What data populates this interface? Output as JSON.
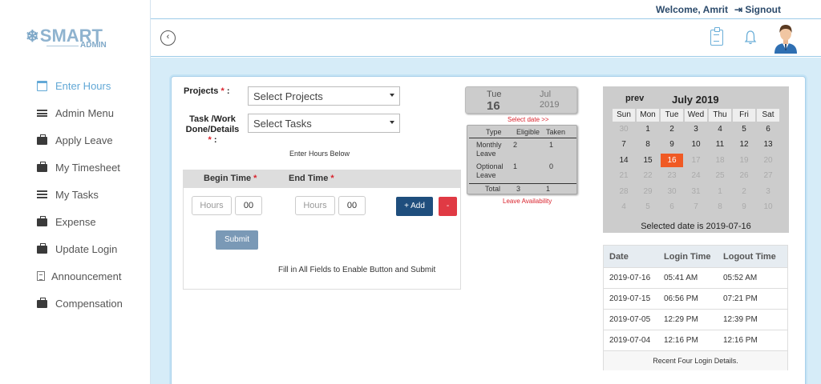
{
  "brand": {
    "name": "SMART",
    "sub": "ADMIN"
  },
  "topbar": {
    "welcome": "Welcome, Amrit",
    "signout": "Signout"
  },
  "sidebar": {
    "items": [
      {
        "label": "Enter Hours",
        "icon": "calendar-icon",
        "active": true
      },
      {
        "label": "Admin Menu",
        "icon": "menu-icon"
      },
      {
        "label": "Apply Leave",
        "icon": "briefcase-icon"
      },
      {
        "label": "My Timesheet",
        "icon": "briefcase-icon"
      },
      {
        "label": "My Tasks",
        "icon": "list-icon"
      },
      {
        "label": "Expense",
        "icon": "briefcase-icon"
      },
      {
        "label": "Update Login",
        "icon": "briefcase-icon"
      },
      {
        "label": "Announcement",
        "icon": "document-icon"
      },
      {
        "label": "Compensation",
        "icon": "briefcase-icon"
      }
    ]
  },
  "form": {
    "projects_label": "Projects",
    "projects_placeholder": "Select Projects",
    "task_label_1": "Task /Work",
    "task_label_2": "Done/Details",
    "tasks_placeholder": "Select Tasks",
    "required_mark": "*",
    "colon": ":",
    "enter_hours_hint": "Enter Hours Below",
    "begin_time": "Begin Time",
    "end_time": "End Time",
    "hours_placeholder": "Hours",
    "minutes_value": "00",
    "add_label": "+ Add",
    "remove_label": "-",
    "submit_label": "Submit",
    "fill_message": "Fill in All Fields to Enable Button and Submit"
  },
  "date_tile": {
    "dow": "Tue",
    "day": "16",
    "month": "Jul",
    "year": "2019"
  },
  "select_date": "Select date >>",
  "leave": {
    "headers": [
      "Type",
      "Eligible",
      "Taken"
    ],
    "rows": [
      {
        "type1": "Monthly",
        "type2": "Leave",
        "eligible": "2",
        "taken": "1"
      },
      {
        "type1": "Optional",
        "type2": "Leave",
        "eligible": "1",
        "taken": "0"
      }
    ],
    "total": {
      "label": "Total",
      "eligible": "3",
      "taken": "1"
    },
    "footer": "Leave Availability"
  },
  "calendar": {
    "prev": "prev",
    "title": "July 2019",
    "dow": [
      "Sun",
      "Mon",
      "Tue",
      "Wed",
      "Thu",
      "Fri",
      "Sat"
    ],
    "weeks": [
      [
        "30",
        "1",
        "2",
        "3",
        "4",
        "5",
        "6"
      ],
      [
        "7",
        "8",
        "9",
        "10",
        "11",
        "12",
        "13"
      ],
      [
        "14",
        "15",
        "16",
        "17",
        "18",
        "19",
        "20"
      ],
      [
        "21",
        "22",
        "23",
        "24",
        "25",
        "26",
        "27"
      ],
      [
        "28",
        "29",
        "30",
        "31",
        "1",
        "2",
        "3"
      ],
      [
        "4",
        "5",
        "6",
        "7",
        "8",
        "9",
        "10"
      ]
    ],
    "selected_day": "16",
    "selected_text": "Selected date is 2019-07-16",
    "colors": {
      "selected": "#f05a24"
    }
  },
  "logins": {
    "headers": [
      "Date",
      "Login Time",
      "Logout Time"
    ],
    "rows": [
      [
        "2019-07-16",
        "05:41 AM",
        "05:52 AM"
      ],
      [
        "2019-07-15",
        "06:56 PM",
        "07:21 PM"
      ],
      [
        "2019-07-05",
        "12:29 PM",
        "12:39 PM"
      ],
      [
        "2019-07-04",
        "12:16 PM",
        "12:16 PM"
      ]
    ],
    "footer": "Recent Four Login Details."
  }
}
